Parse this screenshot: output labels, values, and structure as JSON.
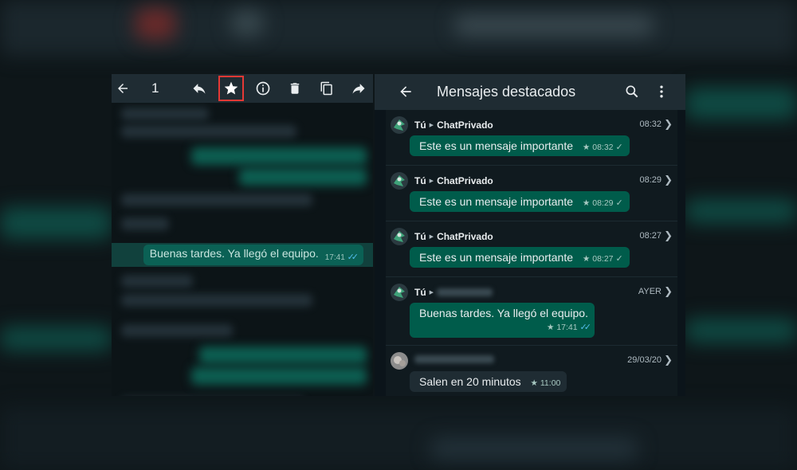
{
  "left_panel": {
    "toolbar": {
      "selected_count": "1",
      "icons": [
        "back-arrow-icon",
        "reply-icon",
        "star-icon",
        "info-icon",
        "delete-icon",
        "copy-icon",
        "forward-icon"
      ]
    },
    "selected_message": {
      "text": "Buenas tardes. Ya llegó el equipo.",
      "time": "17:41"
    }
  },
  "right_panel": {
    "header": {
      "title": "Mensajes destacados"
    },
    "messages": [
      {
        "sender": "Tú",
        "chat": "ChatPrivado",
        "date": "08:32",
        "text": "Este es un mensaje importante",
        "time": "08:32",
        "star": "★",
        "status": "✓"
      },
      {
        "sender": "Tú",
        "chat": "ChatPrivado",
        "date": "08:29",
        "text": "Este es un mensaje importante",
        "time": "08:29",
        "star": "★",
        "status": "✓"
      },
      {
        "sender": "Tú",
        "chat": "ChatPrivado",
        "date": "08:27",
        "text": "Este es un mensaje importante",
        "time": "08:27",
        "star": "★",
        "status": "✓"
      },
      {
        "sender": "Tú",
        "chat": "",
        "date": "AYER",
        "text": "Buenas tardes. Ya llegó el equipo.",
        "time": "17:41",
        "star": "★",
        "status": "✓✓"
      },
      {
        "sender": "",
        "chat": "",
        "date": "29/03/20",
        "text": "Salen en 20 minutos",
        "time": "11:00",
        "star": "★",
        "status": ""
      }
    ]
  },
  "colors": {
    "header_bg": "#1f2c33",
    "outgoing_bubble": "#005c4b",
    "incoming_bubble": "#1f2c33",
    "highlight_box": "#e53935",
    "read_ticks": "#53bdeb"
  }
}
